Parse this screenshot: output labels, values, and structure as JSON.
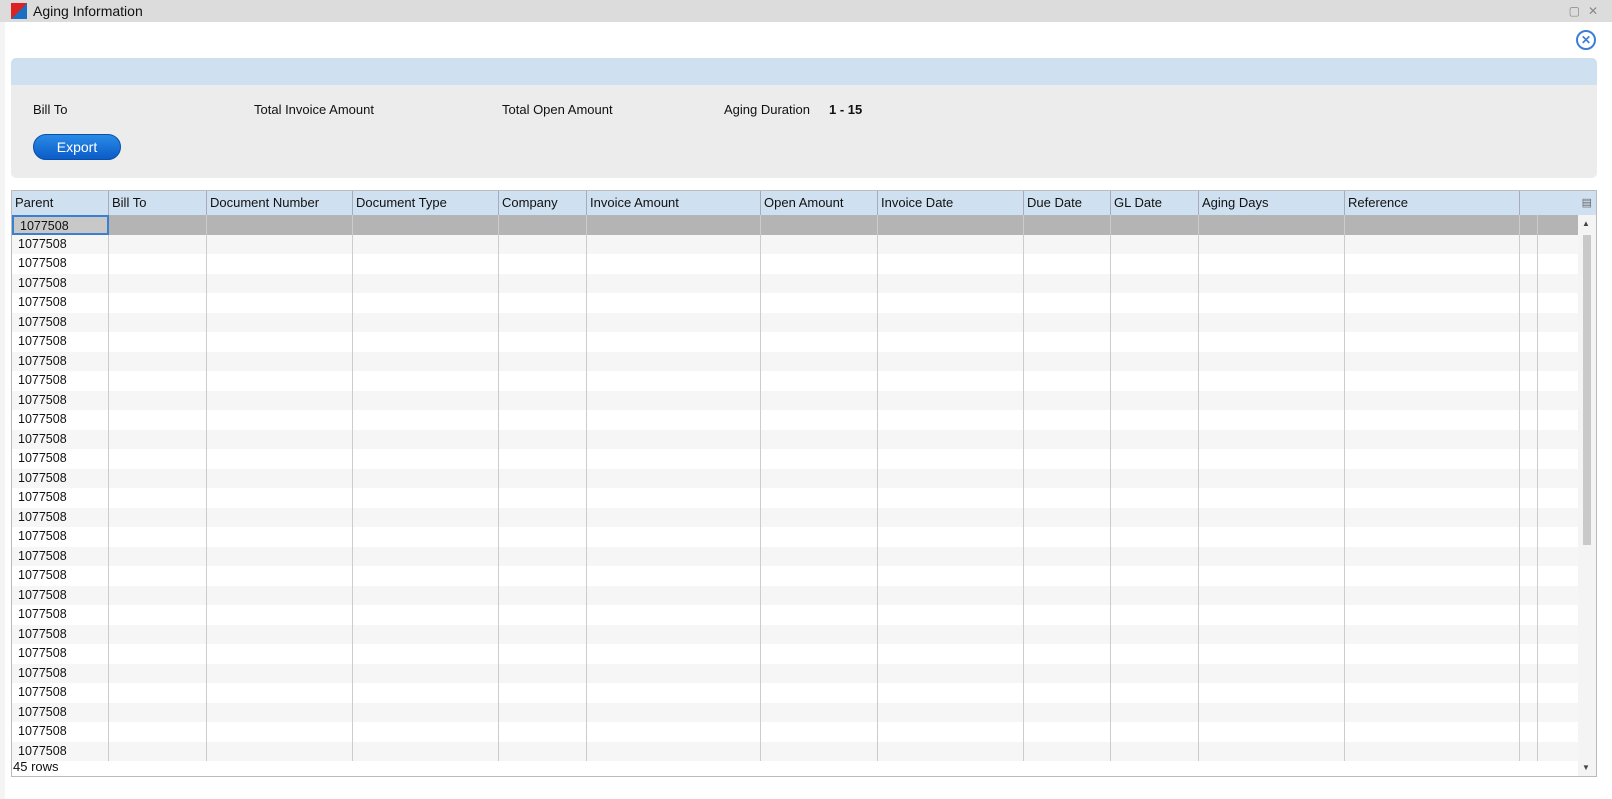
{
  "window": {
    "title": "Aging Information"
  },
  "summary": {
    "bill_to_label": "Bill To",
    "total_invoice_label": "Total Invoice Amount",
    "total_open_label": "Total Open Amount",
    "aging_duration_label": "Aging Duration",
    "aging_duration_value": "1 - 15",
    "export_label": "Export"
  },
  "table": {
    "columns": [
      "Parent",
      "Bill To",
      "Document Number",
      "Document Type",
      "Company",
      "Invoice Amount",
      "Open Amount",
      "Invoice Date",
      "Due Date",
      "GL Date",
      "Aging Days",
      "Reference"
    ],
    "rows": [
      "1077508",
      "1077508",
      "1077508",
      "1077508",
      "1077508",
      "1077508",
      "1077508",
      "1077508",
      "1077508",
      "1077508",
      "1077508",
      "1077508",
      "1077508",
      "1077508",
      "1077508",
      "1077508",
      "1077508",
      "1077508",
      "1077508",
      "1077508",
      "1077508",
      "1077508",
      "1077508",
      "1077508",
      "1077508",
      "1077508",
      "1077508",
      "1077508"
    ],
    "selected_row": 0
  },
  "status": {
    "row_count": "45 rows"
  }
}
